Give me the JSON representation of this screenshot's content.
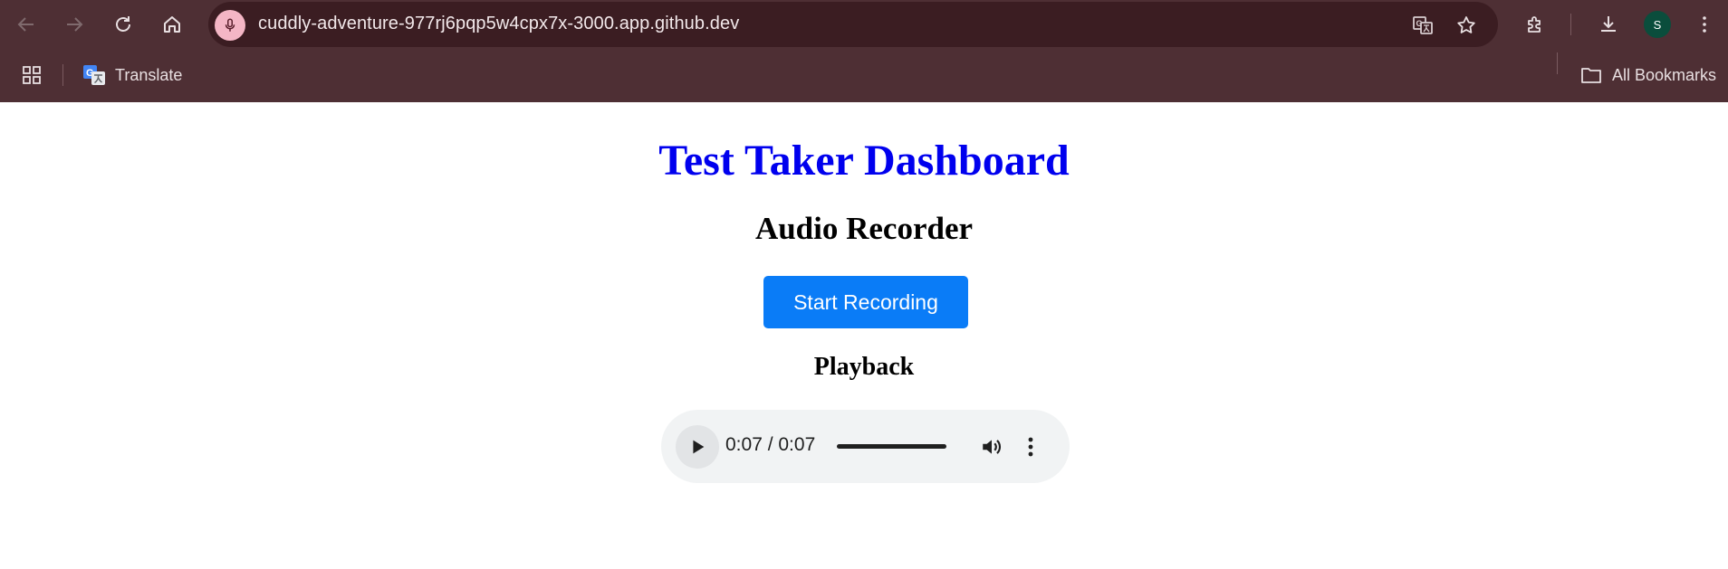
{
  "browser": {
    "url": "cuddly-adventure-977rj6pqp5w4cpx7x-3000.app.github.dev",
    "avatar_initial": "S",
    "bookmarks": {
      "translate_label": "Translate",
      "all_bookmarks_label": "All Bookmarks"
    },
    "colors": {
      "chrome": "#4e2f34",
      "omnibox": "#3b1d22",
      "mic": "#f4b6c5",
      "avatar": "#0a4d3c"
    }
  },
  "page": {
    "title": "Test Taker Dashboard",
    "section_title": "Audio Recorder",
    "record_button": "Start Recording",
    "playback_title": "Playback",
    "player": {
      "time": "0:07 / 0:07",
      "progress": 1.0
    },
    "colors": {
      "title": "#0000ee",
      "button": "#0a7cf7"
    }
  }
}
